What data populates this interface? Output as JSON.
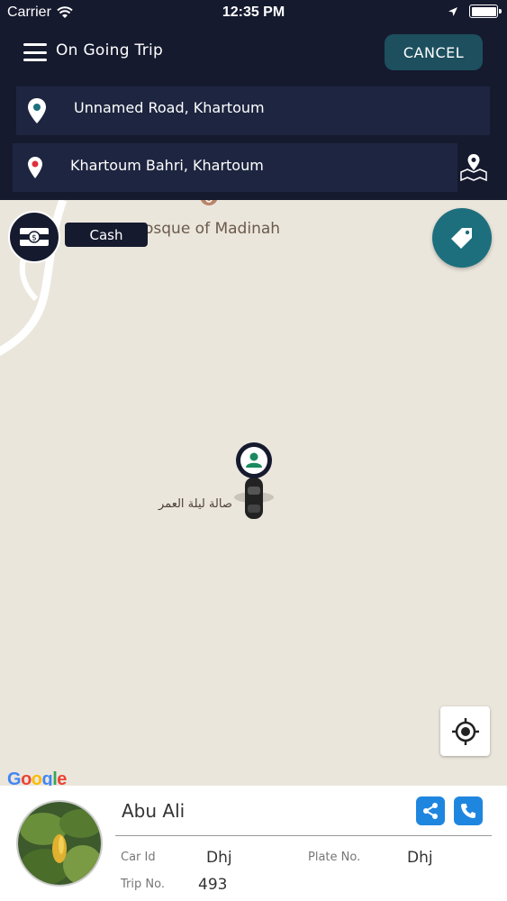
{
  "status_bar": {
    "carrier": "Carrier",
    "time": "12:35 PM"
  },
  "header": {
    "title": "On Going Trip",
    "cancel_label": "CANCEL"
  },
  "pickup": {
    "address": "Unnamed Road, Khartoum"
  },
  "dropoff": {
    "address": "Khartoum Bahri, Khartoum"
  },
  "map": {
    "poi_label": "osque of Madinah",
    "arabic_label": "صالة ليلة العمر",
    "google_logo": "Google"
  },
  "payment": {
    "label": "Cash"
  },
  "driver": {
    "name": "Abu Ali",
    "car_id_label": "Car Id",
    "car_id": "Dhj",
    "plate_label": "Plate No.",
    "plate": "Dhj",
    "trip_label": "Trip No.",
    "trip": "493"
  },
  "colors": {
    "header_bg": "#151a2e",
    "accent": "#1d6f7e",
    "button_blue": "#1f86e0",
    "map_bg": "#ebe6dc"
  }
}
